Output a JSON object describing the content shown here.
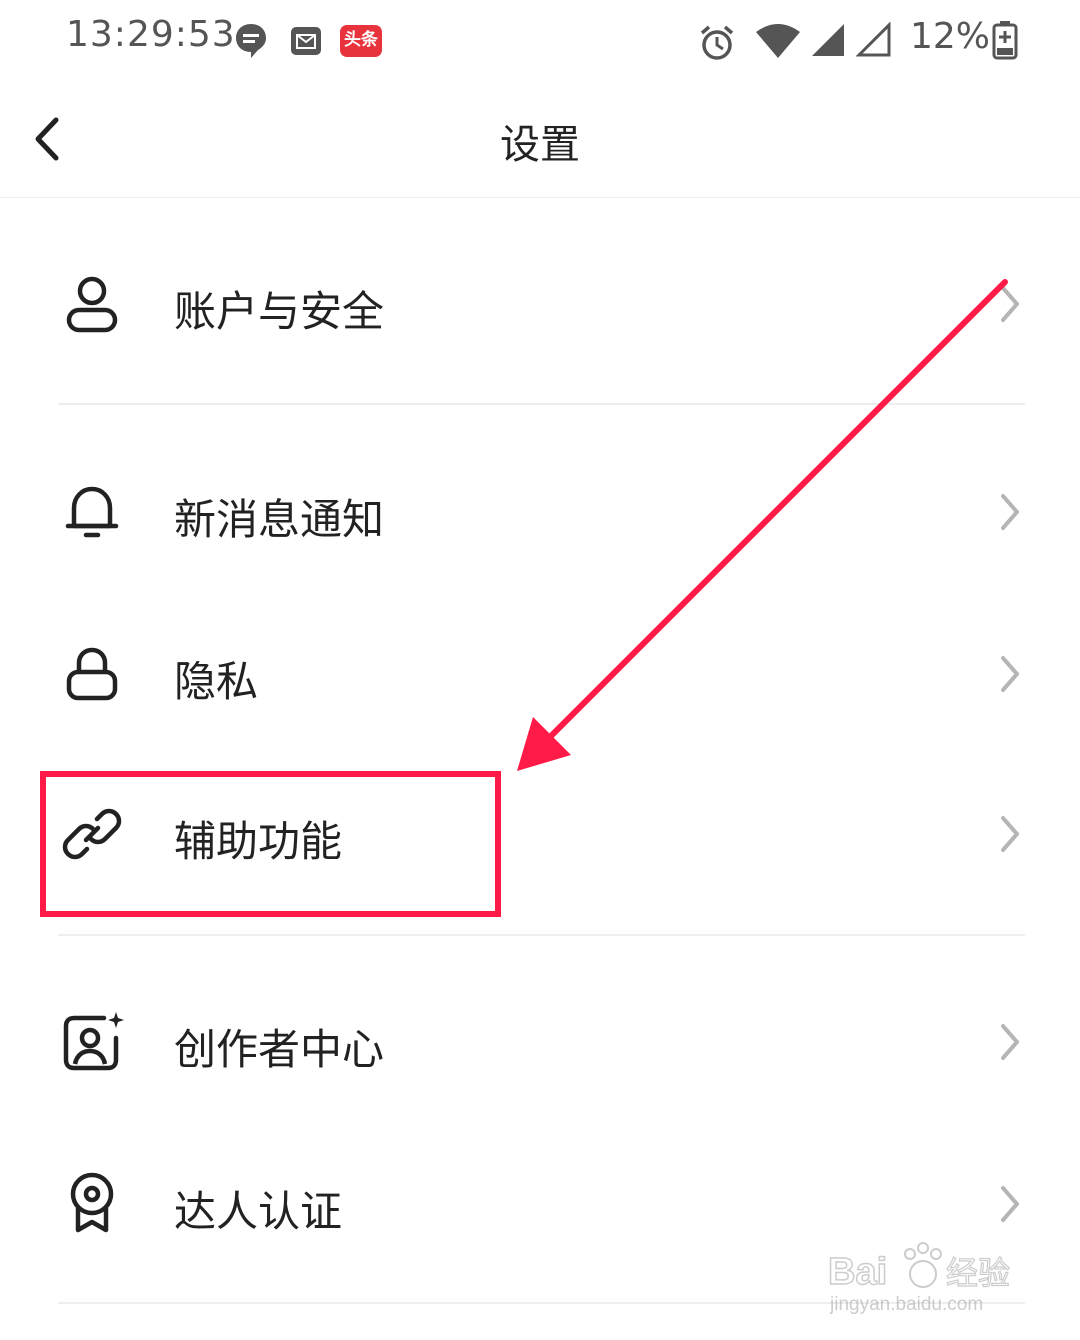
{
  "status_bar": {
    "time": "13:29:53",
    "app_badge": "头条",
    "battery": "12%",
    "icons": [
      "chat-icon",
      "mail-icon",
      "toutiao-app-icon",
      "alarm-icon",
      "wifi-icon",
      "signal-icon",
      "signal-empty-icon",
      "battery-charging-icon"
    ]
  },
  "header": {
    "title": "设置",
    "back_icon": "back-arrow-icon"
  },
  "settings": {
    "items": [
      {
        "label": "账户与安全",
        "icon": "user-icon"
      },
      {
        "label": "新消息通知",
        "icon": "bell-icon"
      },
      {
        "label": "隐私",
        "icon": "lock-icon"
      },
      {
        "label": "辅助功能",
        "icon": "link-icon"
      },
      {
        "label": "创作者中心",
        "icon": "creator-portrait-icon"
      },
      {
        "label": "达人认证",
        "icon": "badge-medal-icon"
      }
    ]
  },
  "annotation": {
    "highlighted_item": "辅助功能",
    "color": "#ff1a47"
  },
  "watermark": {
    "brand": "Bai",
    "brand_suffix": "经验",
    "site": "jingyan.baidu.com"
  }
}
